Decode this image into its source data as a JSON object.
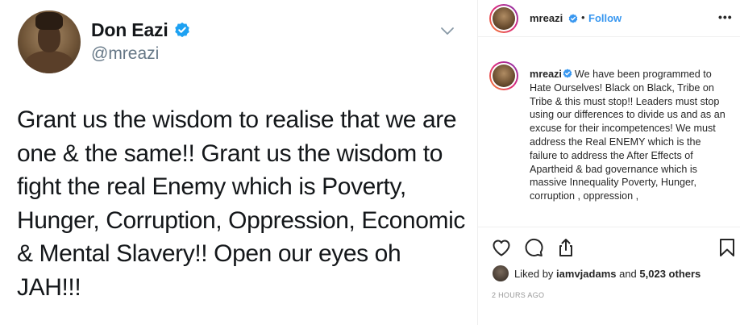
{
  "tweet": {
    "display_name": "Don Eazi",
    "handle": "@mreazi",
    "text": "Grant us the wisdom to realise that we are one & the same!! Grant us the wisdom to fight the real Enemy which is Poverty, Hunger, Corruption, Oppression, Economic & Mental Slavery!! Open our eyes oh JAH!!!",
    "verified_color": "#1da1f2"
  },
  "instagram": {
    "header": {
      "username": "mreazi",
      "separator": "•",
      "follow_label": "Follow",
      "more_label": "•••"
    },
    "caption": {
      "username": "mreazi",
      "text": "We have been programmed to Hate Ourselves! Black on Black, Tribe on Tribe & this must stop!! Leaders must stop using our differences to divide us and as an excuse for their incompetences! We must address the Real ENEMY which is the failure to address the After Effects of Apartheid & bad governance which is massive Innequality Poverty, Hunger, corruption , oppression ,"
    },
    "likes": {
      "prefix": "Liked by ",
      "user": "iamvjadams",
      "middle": " and ",
      "others": "5,023 others"
    },
    "timestamp": "2 HOURS AGO",
    "icons": [
      "heart-icon",
      "comment-icon",
      "share-icon",
      "bookmark-icon"
    ],
    "colors": {
      "follow": "#3897f0",
      "verified": "#3897f0",
      "text": "#262626",
      "muted": "#999999"
    }
  }
}
